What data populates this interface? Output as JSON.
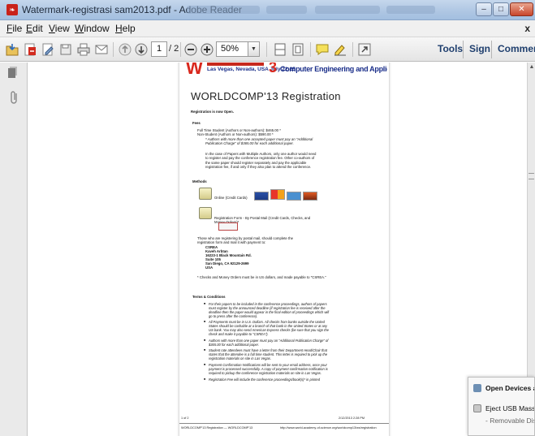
{
  "window": {
    "title": "Watermark-registrasi sam2013.pdf - Adobe Reader",
    "icon": "adobe-reader-icon",
    "min_glyph": "–",
    "max_glyph": "□",
    "close_glyph": "✕"
  },
  "menu": {
    "items": [
      {
        "accel": "F",
        "rest": "ile"
      },
      {
        "accel": "E",
        "rest": "dit"
      },
      {
        "accel": "V",
        "rest": "iew"
      },
      {
        "accel": "W",
        "rest": "indow"
      },
      {
        "accel": "H",
        "rest": "elp"
      }
    ],
    "close_glyph": "x"
  },
  "toolbar": {
    "page_current": "1",
    "page_total": "/ 2",
    "zoom": "50%",
    "zoom_arrow": "▼",
    "tools_label": "Tools",
    "sign_label": "Sign",
    "comment_label": "Comment",
    "icons": [
      "open-icon",
      "create-pdf-icon",
      "edit-icon",
      "save-icon",
      "print-icon",
      "email-icon",
      "previous-page-icon",
      "next-page-icon",
      "zoom-out-icon",
      "zoom-in-icon",
      "fit-width-icon",
      "fit-page-icon",
      "comment-bubble-icon",
      "highlight-icon",
      "expand-icon"
    ]
  },
  "leftpanel": {
    "icons": [
      "pages-panel-icon",
      "attachments-paperclip-icon"
    ]
  },
  "scroll": {
    "up": "▲",
    "down": "▼"
  },
  "pdf": {
    "banner": {
      "logo_letter": "W",
      "place_date": "Las Vegas, Nevada, USA  July 22-25",
      "number": "3",
      "title": "Computer Engineering and Applied Computing"
    },
    "heading": "WORLDCOMP'13 Registration",
    "open_note": "Registration is now Open.",
    "fees_label": "Fees",
    "fee_student": "Full Time Student (Authors or Non-authors): $465.00 *",
    "fee_nonstudent": "Non-Student (Authors or Non-authors): $590.00 *",
    "fee_note": "* Authors with more than one accepted paper must pay an \"Additional Publication Charge\" of $365.00 for each additional paper.",
    "multi_author_note": "In the case of Papers with Multiple Authors, only one author would need to register and pay the conference registration fee. Other co-authors of the same paper should register separately and pay the applicable registration fee, if and only if they also plan to attend the conference.",
    "methods_label": "Methods",
    "online_label": "Online (Credit Cards)",
    "postal_label": "Registration Form - By Postal Mail (Credit Cards, Checks, and Money Orders)*",
    "postal_intro": "Those who are registering by postal mail, should complete the registration form and mail it with payment to:",
    "address": [
      "CSREA",
      "Kaveh Arbtan",
      "16223-1 Black Mountain Rd.",
      "Suite 105",
      "San Diego, CA 92129-2699",
      "USA"
    ],
    "checks_note": "* Checks and Money Orders must be in US dollars, and made payable to \"CSREA.\"",
    "terms_label": "Terms & Conditions",
    "terms": [
      "For their papers to be included in the conference proceedings, authors of papers must register by the announced deadline (if registration fee is received after the deadline then the paper would appear in the final edition of proceedings which will go to press after the conference).",
      "All Payments must be in U.S. Dollars. All checks from banks outside the United States should be cashable at a branch of that bank in the United States or at any US bank. You may also send American Express checks (be sure that you sign the check and make it payable to \"CSREA\").",
      "Authors with more than one paper must pay an \"Additional Publication Charge\" of $365.00 for each additional paper.",
      "Student rate attendees must have a letter from their Department Head/Chair that states that the attendee is a full time student. This letter is required to pick up the registration materials on site in Las Vegas.",
      "Payment Confirmation Notifications will be sent to your email address, once your payment is processed successfully. A copy of payment confirmation notification is required to pickup the conference registration materials on site in Las Vegas.",
      "Registration Fee will include the conference proceedings/book(s)* in printed"
    ],
    "footer_left": "1 of 2",
    "footer_right": "2/12/2013 2:28 PM",
    "footer2_left": "WORLDCOMP'13 Registration — WORLDCOMP'13",
    "footer2_right": "http://www.world-academy-of-science.org/worldcomp13/ws/registration"
  },
  "popup": {
    "open_devices": "Open Devices and",
    "eject": "Eject USB Mass Stor",
    "removable": "-   Removable Disk"
  }
}
